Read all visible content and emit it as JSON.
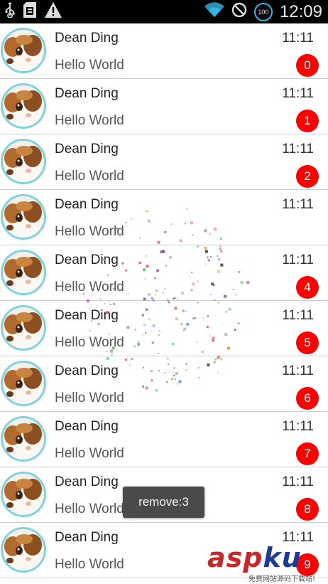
{
  "status_bar": {
    "time": "12:09",
    "battery": "100",
    "icons": [
      "usb-icon",
      "sd-card-icon",
      "warning-icon",
      "wifi-icon",
      "no-sim-icon",
      "battery-icon"
    ]
  },
  "list": {
    "rows": [
      {
        "name": "Dean Ding",
        "message": "Hello World",
        "time": "11:11",
        "badge": "0"
      },
      {
        "name": "Dean Ding",
        "message": "Hello World",
        "time": "11:11",
        "badge": "1"
      },
      {
        "name": "Dean Ding",
        "message": "Hello World",
        "time": "11:11",
        "badge": "2"
      },
      {
        "name": "Dean Ding",
        "message": "Hello World",
        "time": "11:11",
        "badge": ""
      },
      {
        "name": "Dean Ding",
        "message": "Hello World",
        "time": "11:11",
        "badge": "4"
      },
      {
        "name": "Dean Ding",
        "message": "Hello World",
        "time": "11:11",
        "badge": "5"
      },
      {
        "name": "Dean Ding",
        "message": "Hello World",
        "time": "11:11",
        "badge": "6"
      },
      {
        "name": "Dean Ding",
        "message": "Hello World",
        "time": "11:11",
        "badge": "7"
      },
      {
        "name": "Dean Ding",
        "message": "Hello World",
        "time": "11:11",
        "badge": "8"
      },
      {
        "name": "Dean Ding",
        "message": "Hello World",
        "time": "11:11",
        "badge": "9"
      }
    ]
  },
  "toast": {
    "text": "remove:3"
  },
  "watermark": {
    "brand_asp": "asp",
    "brand_ku": "ku",
    "subtitle": "免费网站源码下载站!"
  },
  "colors": {
    "badge": "#ff0000",
    "avatar_ring": "#7fd3e0",
    "divider": "#cfcfcf",
    "status_bar": "#000000"
  }
}
